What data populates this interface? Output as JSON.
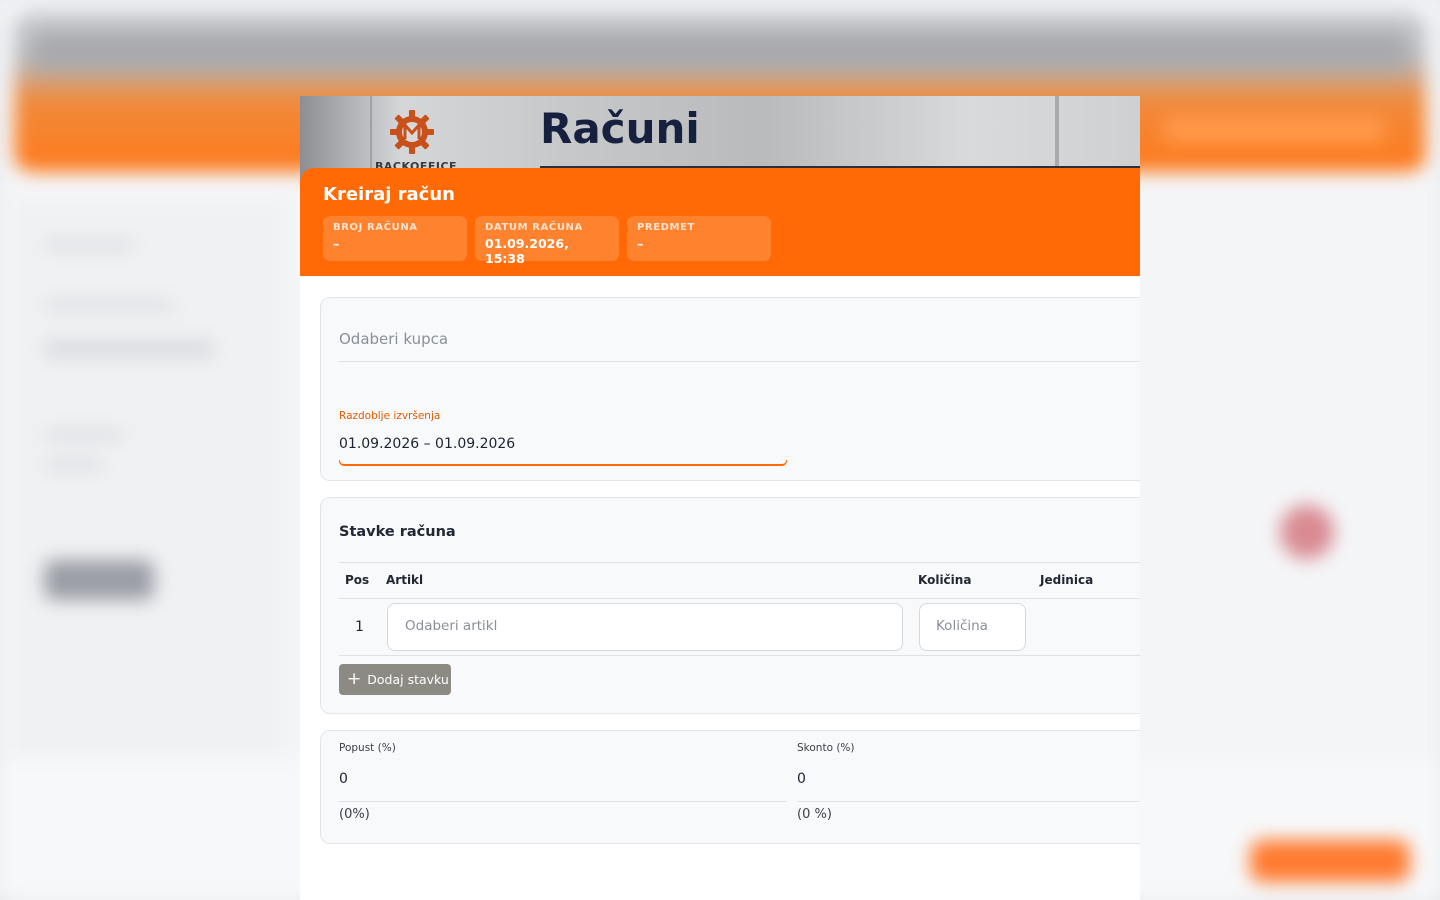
{
  "page": {
    "heading": "Računi",
    "logo_text": "BACKOFFICE"
  },
  "modal": {
    "title": "Kreiraj račun",
    "info": [
      {
        "label": "BROJ RAČUNA",
        "value": "–"
      },
      {
        "label": "DATUM RAČUNA",
        "value": "01.09.2026, 15:38"
      },
      {
        "label": "PREDMET",
        "value": "–"
      }
    ]
  },
  "customer": {
    "placeholder": "Odaberi kupca"
  },
  "period": {
    "label": "Razdoblje izvršenja",
    "value": "01.09.2026 – 01.09.2026"
  },
  "items": {
    "title": "Stavke računa",
    "columns": {
      "pos": "Pos",
      "article": "Artikl",
      "quantity": "Količina",
      "unit": "Jedinica"
    },
    "rows": [
      {
        "pos": "1",
        "article_placeholder": "Odaberi artikl",
        "quantity_placeholder": "Količina"
      }
    ],
    "add_label": "Dodaj stavku"
  },
  "discounts": {
    "popust": {
      "label": "Popust (%)",
      "value": "0",
      "pct": "(0%)"
    },
    "skonto": {
      "label": "Skonto (%)",
      "value": "0",
      "pct": "(0 %)"
    }
  },
  "colors": {
    "accent": "#ff6a06",
    "heading": "#15213e",
    "button": "#8c8a82"
  }
}
